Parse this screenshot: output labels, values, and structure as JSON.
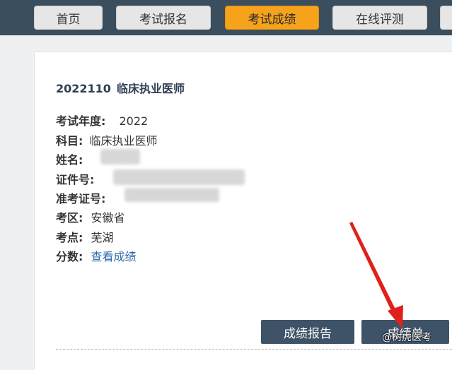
{
  "nav": {
    "tabs": [
      {
        "label": "首页"
      },
      {
        "label": "考试报名"
      },
      {
        "label": "考试成绩"
      },
      {
        "label": "在线评测"
      }
    ]
  },
  "result": {
    "exam_code": "2022110",
    "exam_title": "临床执业医师",
    "fields": [
      {
        "label": "考试年度:",
        "value": "2022"
      },
      {
        "label": "科目:",
        "value": "临床执业医师"
      },
      {
        "label": "姓名:",
        "value": ""
      },
      {
        "label": "证件号:",
        "value": ""
      },
      {
        "label": "准考证号:",
        "value": ""
      },
      {
        "label": "考区:",
        "value": "安徽省"
      },
      {
        "label": "考点:",
        "value": "芜湖"
      },
      {
        "label": "分数:",
        "value": "查看成绩"
      }
    ]
  },
  "actions": {
    "report_label": "成绩报告",
    "sheet_label": "成绩单"
  },
  "watermark": "@树虎医考",
  "colors": {
    "topbar": "#3b4e5e",
    "active_tab": "#f7a21b",
    "button": "#3e5367",
    "link": "#2d6aa8",
    "arrow": "#e0201a"
  }
}
